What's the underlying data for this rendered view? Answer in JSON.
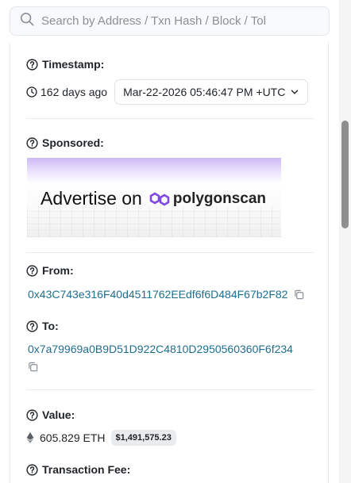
{
  "search": {
    "placeholder": "Search by Address / Txn Hash / Block / Tol"
  },
  "timestamp": {
    "label": "Timestamp:",
    "ago": "162 days ago",
    "value": "Mar-22-2026 05:46:47 PM +UTC"
  },
  "sponsored": {
    "label": "Sponsored:",
    "ad_text": "Advertise on",
    "ad_brand": "polygonscan",
    "accent": "#8247e5"
  },
  "from": {
    "label": "From:",
    "address": "0x43C743e316F40d4511762EEdf6f6D484F67b2F82"
  },
  "to": {
    "label": "To:",
    "address": "0x7a79969a0B9D51D922C4810D2950560360F6f234"
  },
  "value": {
    "label": "Value:",
    "amount": "605.829 ETH",
    "usd": "$1,491,575.23"
  },
  "fee": {
    "label": "Transaction Fee:"
  },
  "colors": {
    "link": "#1e6e8f",
    "text": "#212529",
    "muted": "#8a9099"
  }
}
